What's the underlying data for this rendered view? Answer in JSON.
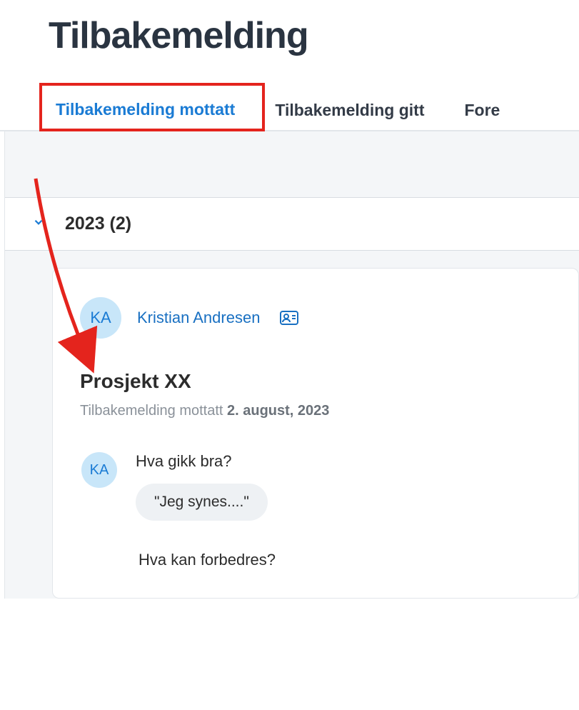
{
  "page": {
    "title": "Tilbakemelding"
  },
  "tabs": {
    "received": "Tilbakemelding mottatt",
    "given": "Tilbakemelding gitt",
    "third": "Fore"
  },
  "year_section": {
    "label": "2023 (2)"
  },
  "card": {
    "author_initials": "KA",
    "author_name": "Kristian Andresen",
    "project_title": "Prosjekt XX",
    "meta_prefix": "Tilbakemelding mottatt ",
    "meta_date": "2. august, 2023",
    "qa_avatar": "KA",
    "question1": "Hva gikk bra?",
    "answer1": "\"Jeg synes....\"",
    "question2": "Hva kan forbedres?"
  }
}
